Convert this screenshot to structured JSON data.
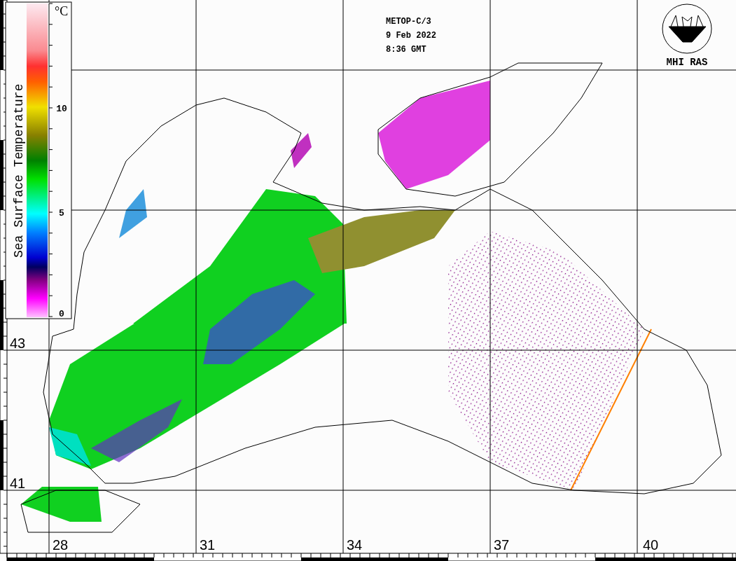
{
  "header": {
    "lines": [
      "METOP-C/3",
      "9 Feb 2022",
      "8:36 GMT"
    ]
  },
  "logo": {
    "text": "MHI RAS"
  },
  "colorbar": {
    "title": "Sea Surface Temperature",
    "unit": "°C",
    "ticks": [
      "10",
      "5",
      "0"
    ]
  },
  "map": {
    "lat_labels": [
      "43",
      "41"
    ],
    "lon_labels": [
      "28",
      "31",
      "34",
      "37",
      "40"
    ]
  }
}
